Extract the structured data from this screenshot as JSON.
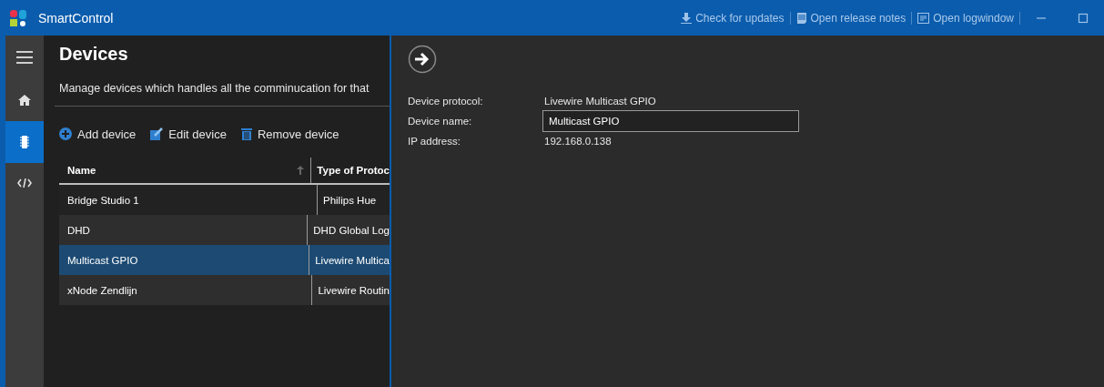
{
  "window": {
    "title": "SmartControl",
    "actions": [
      {
        "label": "Check for updates",
        "kind": "download"
      },
      {
        "label": "Open release notes",
        "kind": "notes"
      },
      {
        "label": "Open logwindow",
        "kind": "log"
      }
    ]
  },
  "nav": [
    {
      "kind": "menu",
      "selected": false
    },
    {
      "kind": "home",
      "selected": false
    },
    {
      "kind": "chip",
      "selected": true
    },
    {
      "kind": "code",
      "selected": false
    }
  ],
  "page": {
    "title": "Devices",
    "description": "Manage devices which handles all the comminucation for that"
  },
  "toolbar": [
    {
      "label": "Add device",
      "kind": "add"
    },
    {
      "label": "Edit device",
      "kind": "edit"
    },
    {
      "label": "Remove device",
      "kind": "remove"
    }
  ],
  "table": {
    "columns": [
      "Name",
      "Type of Protoc"
    ],
    "rows": [
      {
        "cells": [
          "Bridge Studio 1",
          "Philips Hue"
        ],
        "selected": false
      },
      {
        "cells": [
          "DHD",
          "DHD Global Log"
        ],
        "selected": false
      },
      {
        "cells": [
          "Multicast GPIO",
          "Livewire Multica"
        ],
        "selected": true
      },
      {
        "cells": [
          "xNode Zendlijn",
          "Livewire Routin"
        ],
        "selected": false
      }
    ]
  },
  "details": {
    "fields": [
      {
        "label": "Device protocol:",
        "value": "Livewire Multicast GPIO",
        "kind": "text"
      },
      {
        "label": "Device name:",
        "value": "Multicast GPIO",
        "kind": "input"
      },
      {
        "label": "IP address:",
        "value": "192.168.0.138",
        "kind": "text"
      }
    ]
  }
}
